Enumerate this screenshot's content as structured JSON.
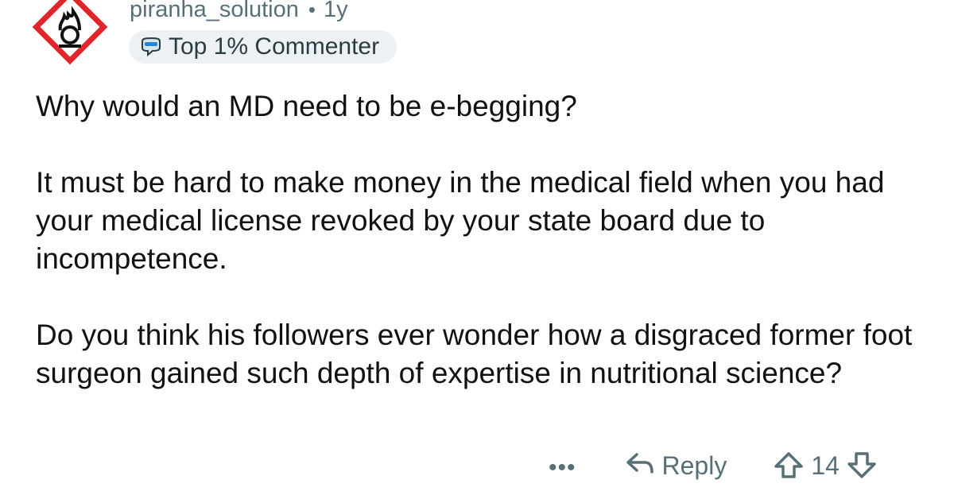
{
  "comment": {
    "author": "piranha_solution",
    "separator": "•",
    "age": "1y",
    "badge": "Top 1% Commenter",
    "paragraphs": [
      "Why would an MD need to be e-begging?",
      "It must be hard to make money in the medical field when you had your medical license revoked by your state board due to incompetence.",
      "Do you think his followers ever wonder how a disgraced former foot surgeon gained such depth of expertise in nutritional science?"
    ]
  },
  "actions": {
    "more": "•••",
    "reply": "Reply",
    "vote_count": "14"
  },
  "icons": {
    "avatar": "oxidizer-hazard-icon",
    "badge": "commenter-badge-icon",
    "reply": "reply-arrow-icon",
    "upvote": "upvote-icon",
    "downvote": "downvote-icon"
  },
  "colors": {
    "avatar_red": "#e0262b",
    "meta_text": "#576f76",
    "badge_bg": "#eef1f3"
  }
}
